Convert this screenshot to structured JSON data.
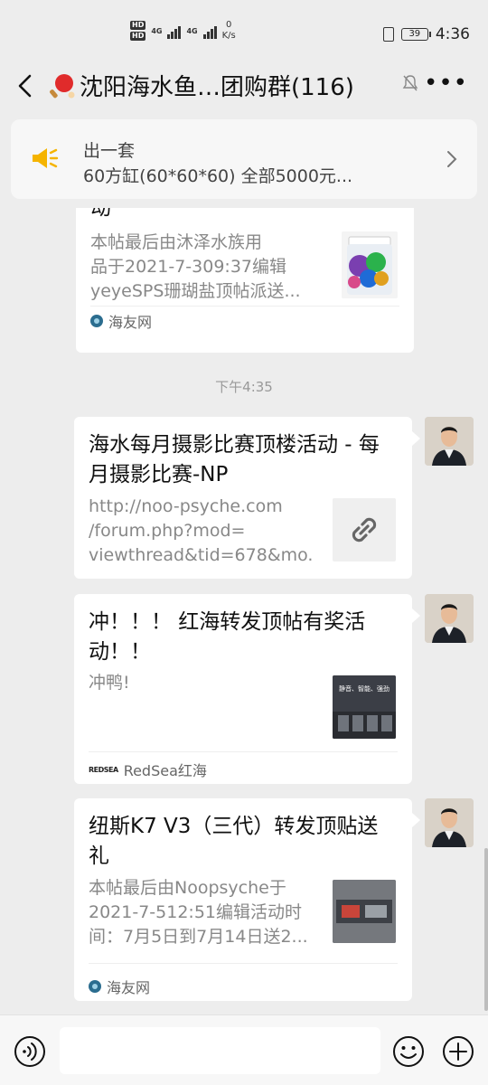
{
  "status_bar": {
    "hd1": "HD",
    "hd2": "HD",
    "net1": "4G",
    "net2": "4G",
    "speed_value": "0",
    "speed_unit": "K/s",
    "battery": "39",
    "time": "4:36"
  },
  "header": {
    "title": "沈阳海水鱼…团购群(116)",
    "icons": [
      "back-arrow-icon",
      "ping-pong-icon",
      "mute-bell-icon",
      "more-icon"
    ]
  },
  "announcement": {
    "line1": "出一套",
    "line2": "60方缸(60*60*60)  全部5000元..."
  },
  "messages": [
    {
      "title": "动",
      "desc": "本帖最后由沐泽水族用\n品于2021-7-309:37编辑\nyeyeSPS珊瑚盐顶帖派送...",
      "source": "海友网"
    },
    {
      "timestamp": "下午4:35"
    },
    {
      "title": "海水每月摄影比赛顶楼活动 - 每月摄影比赛-NP",
      "desc": "http://noo-psyche.com\n/forum.php?mod=\nviewthread&tid=678&mo..."
    },
    {
      "title": "冲！！！ 红海转发顶帖有奖活动！！",
      "desc": "冲鸭!",
      "source": "RedSea红海",
      "source_logo": "REDSEA",
      "thumb_text": "静音、智能、强劲"
    },
    {
      "title": "纽斯K7 V3（三代）转发顶贴送礼",
      "desc": "本帖最后由Noopsyche于\n2021-7-512:51编辑活动时\n间：7月5日到7月14日送2...",
      "source": "海友网"
    }
  ],
  "input_bar": {
    "icons": [
      "voice-icon",
      "emoji-icon",
      "plus-icon"
    ]
  },
  "colors": {
    "background": "#ededed",
    "card": "#ffffff",
    "speaker": "#f5b400",
    "source_icon": "#2b6d8f"
  }
}
